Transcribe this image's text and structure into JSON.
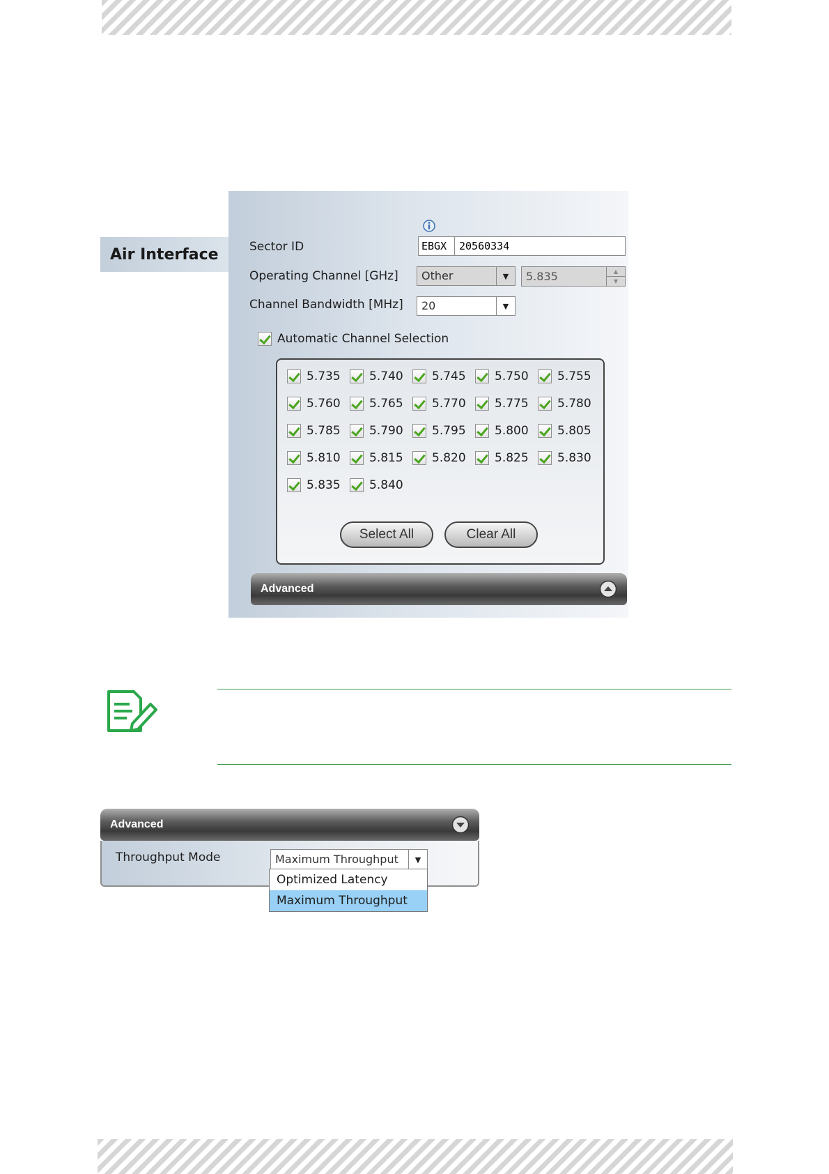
{
  "air_interface": {
    "tab_label": "Air Interface",
    "info_icon": "info-icon",
    "sector_id": {
      "label": "Sector ID",
      "prefix": "EBGX",
      "value": "20560334"
    },
    "operating_channel": {
      "label": "Operating Channel [GHz]",
      "selected": "Other",
      "value": "5.835"
    },
    "channel_bandwidth": {
      "label": "Channel Bandwidth [MHz]",
      "selected": "20"
    },
    "automatic_channel_selection": {
      "label": "Automatic Channel Selection",
      "checked": true
    },
    "channels": [
      "5.735",
      "5.740",
      "5.745",
      "5.750",
      "5.755",
      "5.760",
      "5.765",
      "5.770",
      "5.775",
      "5.780",
      "5.785",
      "5.790",
      "5.795",
      "5.800",
      "5.805",
      "5.810",
      "5.815",
      "5.820",
      "5.825",
      "5.830",
      "5.835",
      "5.840"
    ],
    "select_all_label": "Select All",
    "clear_all_label": "Clear All",
    "advanced_label": "Advanced",
    "advanced_toggle_icon": "collapse-up-icon"
  },
  "note": {
    "icon": "note-pencil-icon",
    "accent_color": "#3d9a4f"
  },
  "advanced_panel": {
    "title": "Advanced",
    "toggle_icon": "expand-down-icon",
    "throughput_mode": {
      "label": "Throughput Mode",
      "selected": "Maximum Throughput",
      "options": [
        "Optimized Latency",
        "Maximum Throughput"
      ],
      "highlighted_option": "Maximum Throughput"
    }
  }
}
